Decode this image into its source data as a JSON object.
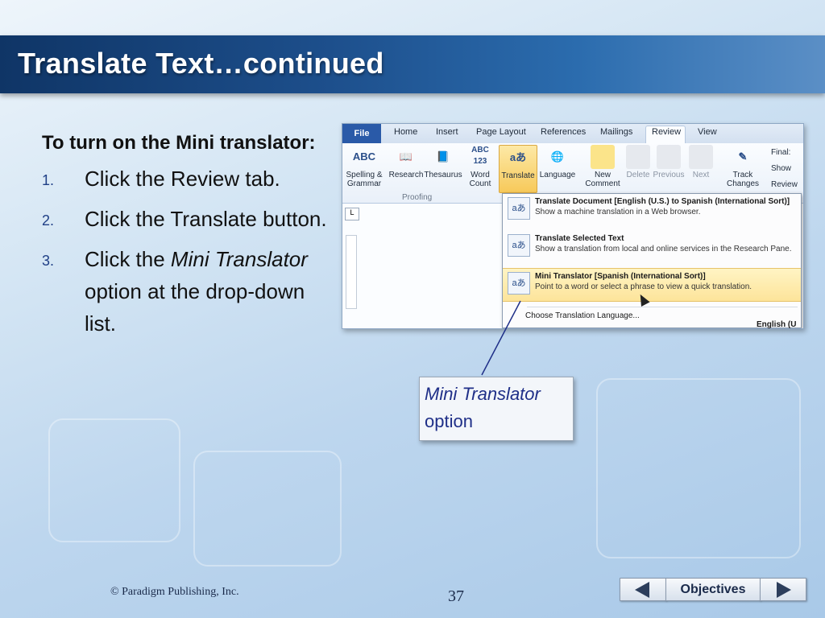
{
  "slide": {
    "title": "Translate Text…continued",
    "lead": "To turn on the Mini translator:",
    "steps": [
      {
        "num": "1.",
        "text": "Click the Review tab."
      },
      {
        "num": "2.",
        "text": "Click the Translate button."
      },
      {
        "num": "3.",
        "pre": "Click the ",
        "italic": "Mini Translator",
        "post": " option at the drop-down list."
      }
    ],
    "callout": {
      "line1": "Mini Translator",
      "line2": "option"
    },
    "footer": {
      "copyright": "© Paradigm Publishing, Inc.",
      "page": "37",
      "nav_label": "Objectives"
    }
  },
  "word_ui": {
    "tabs": [
      "File",
      "Home",
      "Insert",
      "Page Layout",
      "References",
      "Mailings",
      "Review",
      "View"
    ],
    "buttons": {
      "spelling": "Spelling & Grammar",
      "research": "Research",
      "thesaurus": "Thesaurus",
      "word_count": "Word Count",
      "translate": "Translate",
      "language": "Language",
      "new_comment": "New Comment",
      "delete": "Delete",
      "previous": "Previous",
      "next": "Next",
      "track_changes": "Track Changes",
      "final": "Final:",
      "show": "Show",
      "review": "Review"
    },
    "group_proofing": "Proofing",
    "menu": {
      "item1_title": "Translate Document [English (U.S.) to Spanish (International Sort)]",
      "item1_desc": "Show a machine translation in a Web browser.",
      "item2_title": "Translate Selected Text",
      "item2_desc": "Show a translation from local and online services in the Research Pane.",
      "item3_title": "Mini Translator [Spanish (International Sort)]",
      "item3_desc": "Point to a word or select a phrase to view a quick translation.",
      "footer": "Choose Translation Language..."
    },
    "status_fragment": "English (U"
  }
}
